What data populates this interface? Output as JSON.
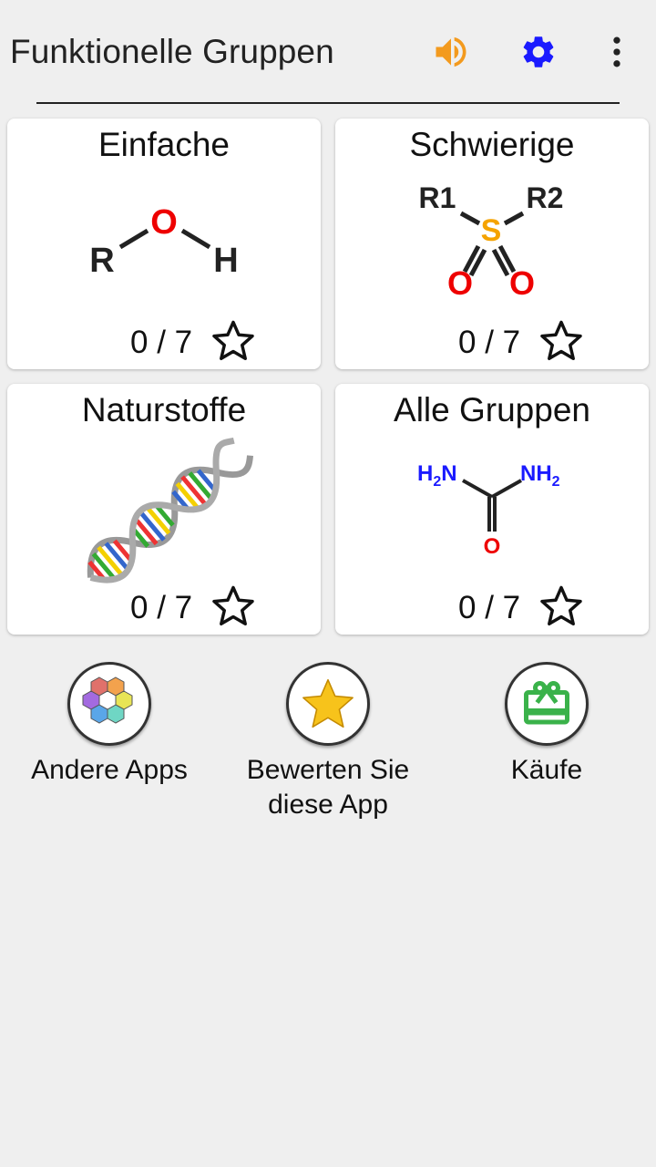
{
  "appbar": {
    "title": "Funktionelle Gruppen",
    "icons": [
      "speaker-icon",
      "gear-icon",
      "more-vert-icon"
    ],
    "colors": {
      "speaker": "#f39a1e",
      "gear": "#1a1aff"
    }
  },
  "cards": [
    {
      "title": "Einfache",
      "score": "0 / 7",
      "molecule": {
        "R": "R",
        "O": "O",
        "H": "H"
      }
    },
    {
      "title": "Schwierige",
      "score": "0 / 7",
      "molecule": {
        "R1": "R1",
        "R2": "R2",
        "S": "S",
        "O1": "O",
        "O2": "O"
      }
    },
    {
      "title": "Naturstoffe",
      "score": "0 / 7"
    },
    {
      "title": "Alle Gruppen",
      "score": "0 / 7",
      "molecule": {
        "H2N": "H",
        "N_left": "N",
        "NH2": "NH",
        "O": "O",
        "sub2": "2"
      }
    }
  ],
  "bottom": [
    {
      "label": "Andere Apps",
      "icon": "hexagons-icon"
    },
    {
      "label": "Bewerten Sie diese App",
      "icon": "star-icon"
    },
    {
      "label": "Käufe",
      "icon": "gift-icon"
    }
  ]
}
